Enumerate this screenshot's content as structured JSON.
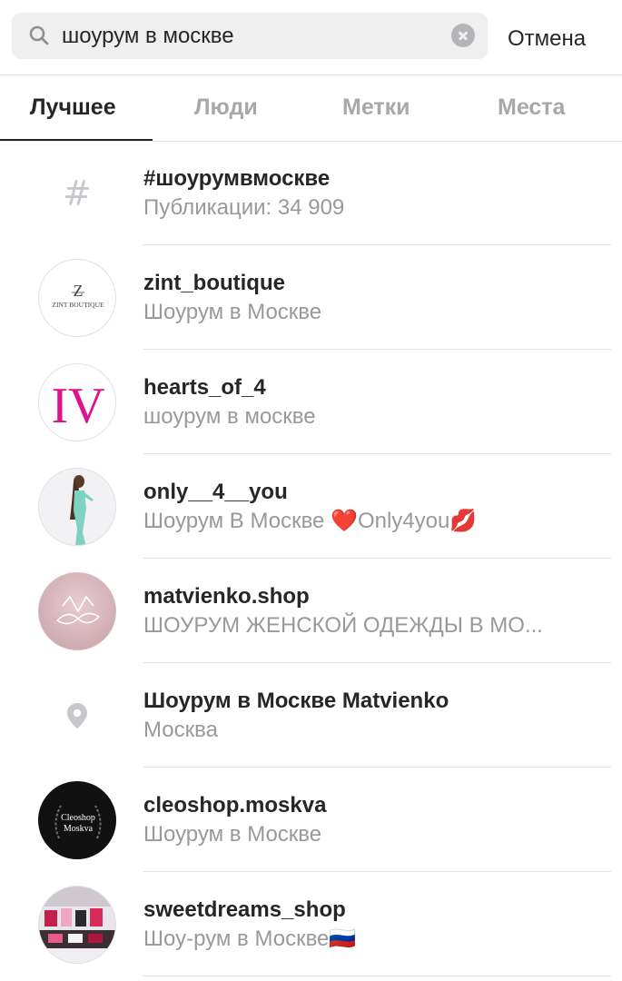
{
  "search": {
    "query": "шоурум в москве",
    "cancel_label": "Отмена"
  },
  "tabs": [
    {
      "label": "Лучшее",
      "active": true
    },
    {
      "label": "Люди",
      "active": false
    },
    {
      "label": "Метки",
      "active": false
    },
    {
      "label": "Места",
      "active": false
    }
  ],
  "results": [
    {
      "kind": "hashtag",
      "title": "#шоурумвмоскве",
      "subtitle": "Публикации: 34 909",
      "icon": "hashtag-icon"
    },
    {
      "kind": "account",
      "title": "zint_boutique",
      "subtitle": "Шоурум в Москве",
      "avatar_logo": "Z",
      "avatar_text": "ZINT BOUTIQUE"
    },
    {
      "kind": "account",
      "title": "hearts_of_4",
      "subtitle": "шоурум в москве",
      "avatar_logo": "IV"
    },
    {
      "kind": "account",
      "title": "only__4__you",
      "subtitle": "Шоурум В Москве ❤️Only4you💋"
    },
    {
      "kind": "account",
      "title": "matvienko.shop",
      "subtitle": "ШОУРУМ ЖЕНСКОЙ ОДЕЖДЫ В МО..."
    },
    {
      "kind": "place",
      "title": "Шоурум в Москве Matvienko",
      "subtitle": "Москва",
      "icon": "location-pin-icon"
    },
    {
      "kind": "account",
      "title": "cleoshop.moskva",
      "subtitle": "Шоурум в Москве",
      "avatar_text": "Cleoshop Moskva"
    },
    {
      "kind": "account",
      "title": "sweetdreams_shop",
      "subtitle": "Шоу-рум в Москве🇷🇺"
    }
  ],
  "colors": {
    "text": "#262626",
    "secondary": "#999999",
    "search_bg": "#efeff0",
    "iv_logo": "#e0118c"
  }
}
